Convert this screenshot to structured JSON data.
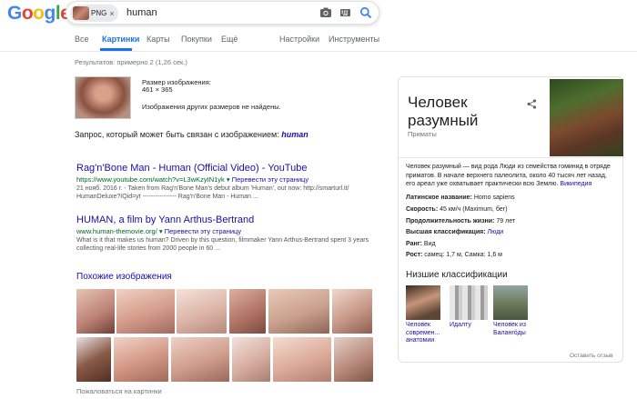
{
  "header": {
    "logo_letters": [
      {
        "ch": "G",
        "color": "#4285f4"
      },
      {
        "ch": "o",
        "color": "#ea4335"
      },
      {
        "ch": "o",
        "color": "#fbbc05"
      },
      {
        "ch": "g",
        "color": "#4285f4"
      },
      {
        "ch": "l",
        "color": "#34a853"
      },
      {
        "ch": "e",
        "color": "#ea4335"
      }
    ],
    "chip_label": "PNG",
    "chip_close": "×",
    "query": "human"
  },
  "tabs": [
    {
      "label": "Все",
      "active": false
    },
    {
      "label": "Картинки",
      "active": true
    },
    {
      "label": "Карты",
      "active": false
    },
    {
      "label": "Покупки",
      "active": false
    },
    {
      "label": "Ещё",
      "active": false
    },
    {
      "label": "Настройки",
      "active": false
    },
    {
      "label": "Инструменты",
      "active": false
    }
  ],
  "result_stats": "Результатов: примерно 2 (1,26 сек.)",
  "image_info": {
    "size_label": "Размер изображения:",
    "size_value": "461 × 365",
    "no_other_sizes": "Изображения других размеров не найдены."
  },
  "related_query": {
    "prefix": "Запрос, который может быть связан с изображением:",
    "link": "human"
  },
  "results": [
    {
      "title": "Rag'n'Bone Man - Human (Official Video) - YouTube",
      "url": "https://www.youtube.com/watch?v=L3wKzyIN1yk",
      "translate": "Перевести эту страницу",
      "snippet_1": "21 нояб. 2016 г. - Taken from Rag'n'Bone Man's debut album 'Human', out now: http://smarturl.it/",
      "snippet_2": "HumanDeluxe?IQid=yt ---------------- Rag'n'Bone Man - Human ..."
    },
    {
      "title": "HUMAN, a film by Yann Arthus-Bertrand",
      "url": "www.human-themovie.org/",
      "translate": "Перевести эту страницу",
      "snippet_1": "What is it that makes us human? Driven by this question, filmmaker Yann Arthus-Bertrand spent 3 years",
      "snippet_2": "collecting real-life stories from 2000 people in 60 ..."
    }
  ],
  "similar_images": {
    "header": "Похожие изображения",
    "report": "Пожаловаться на картинки"
  },
  "knowledge_panel": {
    "title": "Человек разумный",
    "subtitle": "Приматы",
    "description": "Человек разумный — вид рода Люди из семейства гоминид в отряде приматов. В начале верхнего палеолита, около 40 тысяч лет назад, его ареал уже охватывает практически всю Землю.",
    "wiki_link": "Википедия",
    "facts": [
      {
        "label": "Латинское название:",
        "value": "Homo sapiens",
        "link": false
      },
      {
        "label": "Скорость:",
        "value": "45 км/ч (Maximum, бег)",
        "link": false
      },
      {
        "label": "Продолжительность жизни:",
        "value": "79 лет",
        "link": false
      },
      {
        "label": "Высшая классификация:",
        "value": "Люди",
        "link": true
      },
      {
        "label": "Ранг:",
        "value": "Вид",
        "link": false
      },
      {
        "label": "Рост:",
        "value": "самец: 1,7 м, Самка: 1,6 м",
        "link": false
      }
    ],
    "lower_header": "Низшие классификации",
    "lower_items": [
      {
        "caption_1": "Человек",
        "caption_2": "современ...",
        "caption_3": "анатомии"
      },
      {
        "caption_1": "Идалту",
        "caption_2": "",
        "caption_3": ""
      },
      {
        "caption_1": "Человек из",
        "caption_2": "Баланго́ды",
        "caption_3": ""
      }
    ],
    "feedback": "Оставить отзыв"
  }
}
